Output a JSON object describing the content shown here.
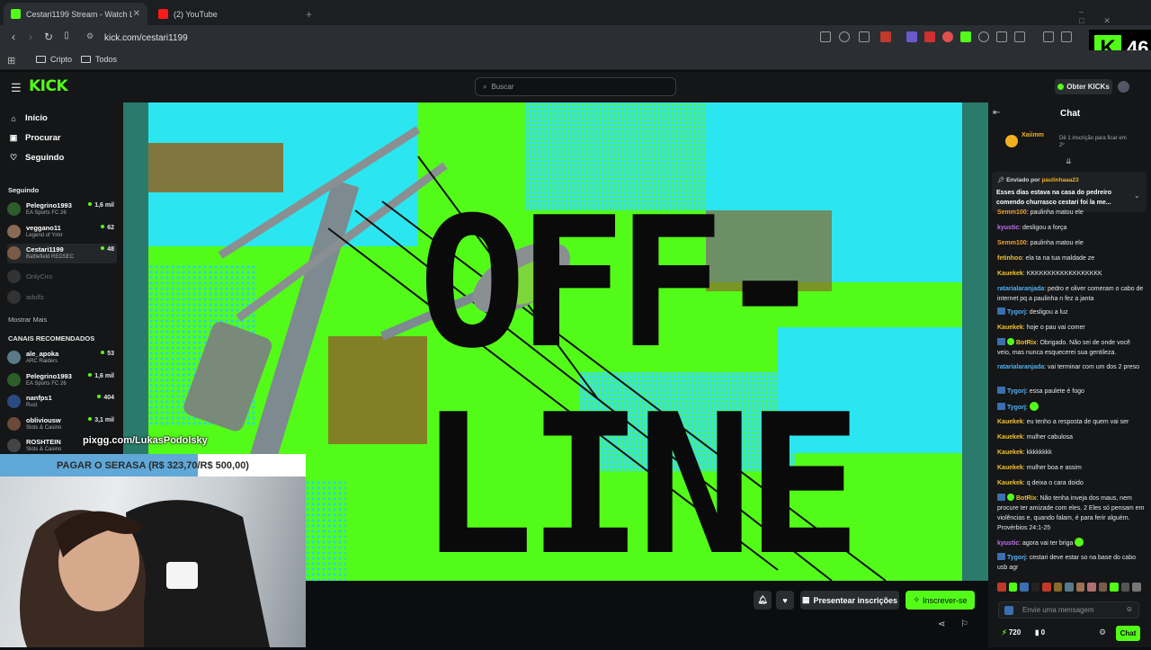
{
  "browser": {
    "tabs": [
      {
        "title": "Cestari1199 Stream - Watch Live",
        "close": "✕"
      },
      {
        "title": "(2) YouTube"
      }
    ],
    "new_tab": "+",
    "url": "kick.com/cestari1199",
    "bookmarks": [
      "Cripto",
      "Todos"
    ]
  },
  "overlay_badge": {
    "logo": "K",
    "count": "46"
  },
  "header": {
    "logo": "KICK",
    "search_placeholder": "Buscar",
    "get_kicks": "Obter KICKs"
  },
  "sidebar": {
    "nav": [
      "Início",
      "Procurar",
      "Seguindo"
    ],
    "following_title": "Seguindo",
    "following": [
      {
        "name": "Pelegrino1993",
        "game": "EA Sports FC 26",
        "viewers": "1,6 mil",
        "color": "#2d5e2a"
      },
      {
        "name": "veggano11",
        "game": "Legend of Ymir",
        "viewers": "62",
        "color": "#8a6a55"
      },
      {
        "name": "Cestari1199",
        "game": "Battlefield REDSEC",
        "viewers": "48",
        "color": "#7a5b48"
      }
    ],
    "offline": [
      "OnlyCiro",
      "adolfz"
    ],
    "show_more": "Mostrar Mais",
    "recommended_title": "CANAIS RECOMENDADOS",
    "recommended": [
      {
        "name": "ale_apoka",
        "game": "ARC Raiders",
        "viewers": "53",
        "color": "#5a7a8a"
      },
      {
        "name": "Pelegrino1993",
        "game": "EA Sports FC 26",
        "viewers": "1,6 mil",
        "color": "#2d5e2a"
      },
      {
        "name": "nanfps1",
        "game": "Rust",
        "viewers": "404",
        "color": "#2b4a80"
      },
      {
        "name": "obliviousw",
        "game": "Slots & Casino",
        "viewers": "3,1 mil",
        "color": "#6b4a3a"
      },
      {
        "name": "ROSHTEIN",
        "game": "Slots & Casino",
        "viewers": "",
        "color": "#444"
      }
    ]
  },
  "stream": {
    "offline_word1": "OFF-",
    "offline_word2": "LINE",
    "pix_text": "pixgg.com/LukasPodolsky",
    "goal_text": "PAGAR O SERASA (R$ 323,70/R$ 500,00)",
    "goal_progress": 0.647,
    "buttons": {
      "gift": "Presentear inscrições",
      "subscribe": "Inscrever-se"
    }
  },
  "chat": {
    "title": "Chat",
    "top_user": "Xaiimm",
    "top_note": "Dê 1 inscrição para ficar em 2º",
    "pinned_by_label": "Enviado por",
    "pinned_by": "paulinhaaa23",
    "pinned_text": "Esses dias estava na casa do pedreiro comendo churrasco cestari foi la me...",
    "messages": [
      {
        "user": "Semm100",
        "color": "#f0a030",
        "text": "paulinha matou ele",
        "bot": false
      },
      {
        "user": "kyustic",
        "color": "#c070f0",
        "text": "desligou a força",
        "bot": false
      },
      {
        "user": "Semm100",
        "color": "#f0a030",
        "text": "paulinha matou ele",
        "bot": false
      },
      {
        "user": "fetinhoo",
        "color": "#f0c030",
        "text": "ela ta na tua maldade ze",
        "bot": false
      },
      {
        "user": "Kauekek",
        "color": "#f0c030",
        "text": "KKKKKKKKKKKKKKKKKK",
        "bot": false
      },
      {
        "user": "ratarialaranjada",
        "color": "#50b0f0",
        "text": "pedro e oliver comeram o cabo de internet pq a paulinha n fez a janta",
        "bot": false
      },
      {
        "user": "Tygorj",
        "color": "#50b0f0",
        "text": "desligou a luz",
        "bot": true
      },
      {
        "user": "Kauekek",
        "color": "#f0c030",
        "text": "hoje o pau vai comer",
        "bot": false
      },
      {
        "user": "BotRix",
        "color": "#f0c030",
        "text": "Obrigado. Não sei de onde você veio, mas nunca esquecerei sua gentileza.",
        "bot": true
      },
      {
        "user": "ratarialaranjada",
        "color": "#50b0f0",
        "text": "vai terminar com um dos 2 preso",
        "bot": false
      },
      {
        "user": "Tygorj",
        "color": "#50b0f0",
        "text": "essa paulete é fogo",
        "bot": true
      },
      {
        "user": "Tygorj",
        "color": "#50b0f0",
        "text": "",
        "bot": true
      },
      {
        "user": "Kauekek",
        "color": "#f0c030",
        "text": "eu tenho a resposta de quem vai ser",
        "bot": false
      },
      {
        "user": "Kauekek",
        "color": "#f0c030",
        "text": "mulher cabulosa",
        "bot": false
      },
      {
        "user": "Kauekek",
        "color": "#f0c030",
        "text": "kkkkkkkk",
        "bot": false
      },
      {
        "user": "Kauekek",
        "color": "#f0c030",
        "text": "mulher boa e assim",
        "bot": false
      },
      {
        "user": "Kauekek",
        "color": "#f0c030",
        "text": "q deixa o cara doido",
        "bot": false
      },
      {
        "user": "BotRix",
        "color": "#f0c030",
        "text": "Não tenha inveja dos maus, nem procure ter amizade com eles. 2 Eles só pensam em violências e, quando falam, é para ferir alguém. Provérbios 24:1-25",
        "bot": true
      },
      {
        "user": "kyustic",
        "color": "#c070f0",
        "text": "agora vai ter briga",
        "bot": false
      },
      {
        "user": "Tygorj",
        "color": "#50b0f0",
        "text": "cestari deve estar so na base do cabo usb agr",
        "bot": true
      }
    ],
    "input_placeholder": "Envie uma mensagem",
    "kicks": "720",
    "count": "0",
    "send": "Chat"
  }
}
